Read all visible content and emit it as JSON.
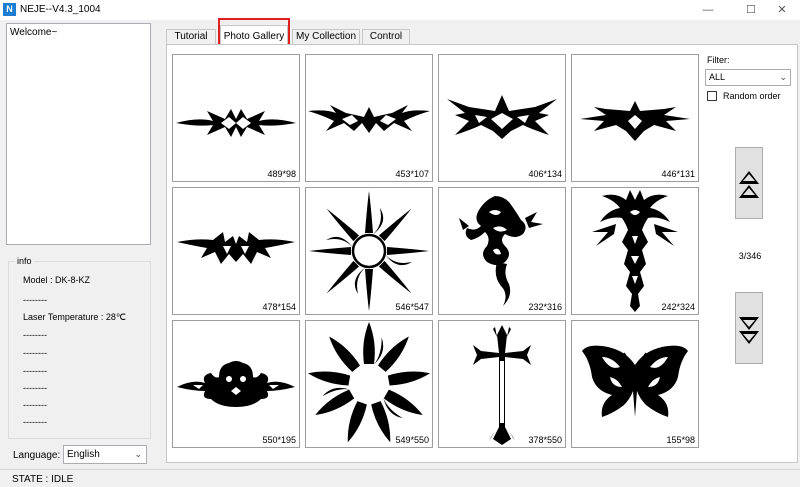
{
  "app": {
    "title": "NEJE--V4.3_1004",
    "icon_glyph": "N"
  },
  "window_controls": {
    "minimize": "—",
    "maximize": "☐",
    "close": "✕"
  },
  "log": {
    "text": "Welcome~"
  },
  "info": {
    "title": "info",
    "model": "Model : DK-8-KZ",
    "sep1": "--------",
    "laser_temp": "Laser Temperature : 28℃",
    "sep2": "--------",
    "sep3": "--------",
    "sep4": "--------",
    "sep5": "--------",
    "sep6": "--------",
    "sep7": "--------"
  },
  "language": {
    "label": "Language:",
    "value": "English"
  },
  "status": {
    "text": "STATE : IDLE"
  },
  "tabs": [
    {
      "label": "Tutorial"
    },
    {
      "label": "Photo Gallery"
    },
    {
      "label": "My Collection"
    },
    {
      "label": "Control"
    }
  ],
  "filter": {
    "label": "Filter:",
    "value": "ALL"
  },
  "random_order": {
    "label": "Random order",
    "checked": false
  },
  "pagination": {
    "text": "3/346"
  },
  "gallery": [
    {
      "dims": "489*98",
      "icon": "tribal-band-icon"
    },
    {
      "dims": "453*107",
      "icon": "tribal-band-icon"
    },
    {
      "dims": "406*134",
      "icon": "tribal-band-icon"
    },
    {
      "dims": "446*131",
      "icon": "tribal-band-icon"
    },
    {
      "dims": "478*154",
      "icon": "tribal-band-icon"
    },
    {
      "dims": "546*547",
      "icon": "tribal-sun-icon"
    },
    {
      "dims": "232*316",
      "icon": "dragon-icon"
    },
    {
      "dims": "242*324",
      "icon": "tribal-figure-icon"
    },
    {
      "dims": "550*195",
      "icon": "lion-band-icon"
    },
    {
      "dims": "549*550",
      "icon": "tribal-sun-icon"
    },
    {
      "dims": "378*550",
      "icon": "cross-icon"
    },
    {
      "dims": "155*98",
      "icon": "butterfly-icon"
    }
  ]
}
